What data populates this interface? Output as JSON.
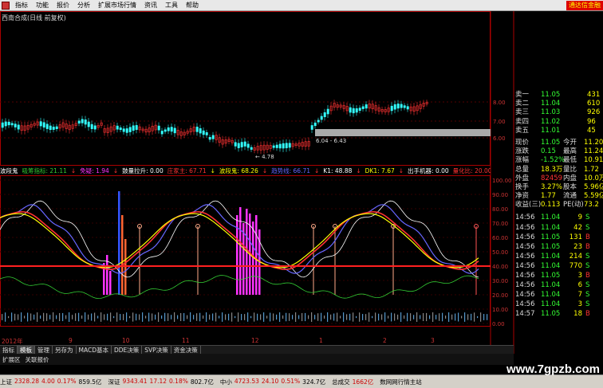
{
  "menu": {
    "items": [
      "指标",
      "功能",
      "报价",
      "分析",
      "扩展市场行情",
      "资讯",
      "工具",
      "帮助"
    ],
    "right_label": "通达信金融"
  },
  "main_title": "西南合成(日线 前复权)",
  "price_axis": [
    "8.00",
    "7.00",
    "6.00"
  ],
  "annotations": {
    "range": "6.04 - 6.43",
    "low": "4.78"
  },
  "indicator_line": [
    {
      "text": "波段鬼",
      "color": "#ffffff"
    },
    {
      "text": "吸筹指标: 21.11",
      "color": "#33cc33"
    },
    {
      "text": "↓",
      "color": "#ff3333"
    },
    {
      "text": "免疑: 1.94",
      "color": "#ff33ff"
    },
    {
      "text": "↓",
      "color": "#ff3333"
    },
    {
      "text": "鼓量拉升: 0.00",
      "color": "#ffffff"
    },
    {
      "text": "庄家主: 67.71",
      "color": "#ff3333"
    },
    {
      "text": "↓",
      "color": "#ffff00"
    },
    {
      "text": "波段鬼: 68.26",
      "color": "#ffff00"
    },
    {
      "text": "↓",
      "color": "#ff3333"
    },
    {
      "text": "趋势线: 66.71",
      "color": "#6666ff"
    },
    {
      "text": "↓",
      "color": "#ff3333"
    },
    {
      "text": "K1: 48.88",
      "color": "#ffffff"
    },
    {
      "text": "↓",
      "color": "#ff3333"
    },
    {
      "text": "DK1: 7.67",
      "color": "#ffff00"
    },
    {
      "text": "↓",
      "color": "#ff3333"
    },
    {
      "text": "出手机器: 0.00",
      "color": "#ffffff"
    },
    {
      "text": "量化比: 20.00",
      "color": "#ff3333"
    }
  ],
  "osc_axis": [
    "100.00",
    "90.00",
    "80.00",
    "70.00",
    "60.00",
    "50.00",
    "40.00",
    "30.00",
    "20.00",
    "10.00",
    "0.00"
  ],
  "quote": {
    "asks": [
      {
        "label": "卖一",
        "price": "11.05",
        "vol": "431"
      },
      {
        "label": "卖二",
        "price": "11.04",
        "vol": "610"
      },
      {
        "label": "卖三",
        "price": "11.03",
        "vol": "926"
      },
      {
        "label": "卖四",
        "price": "11.02",
        "vol": "96"
      },
      {
        "label": "卖五",
        "price": "11.01",
        "vol": "45"
      }
    ],
    "stats": [
      [
        "现价",
        "11.05",
        "今开",
        "11.20"
      ],
      [
        "涨跌",
        "0.15",
        "最高",
        "11.24"
      ],
      [
        "涨幅",
        "-1.52%",
        "最低",
        "10.91"
      ],
      [
        "总量",
        "18.3万",
        "量比",
        "1.72"
      ],
      [
        "外盘",
        "82459",
        "内盘",
        "10.0万"
      ],
      [
        "换手",
        "3.27%",
        "股本",
        "5.96亿"
      ],
      [
        "净资",
        "1.77",
        "流通",
        "5.59亿"
      ],
      [
        "收益(三)",
        "0.113",
        "PE(动)",
        "73.2"
      ]
    ]
  },
  "ticks": [
    {
      "time": "14:56",
      "price": "11.04",
      "vol": "9",
      "side": "S"
    },
    {
      "time": "14:56",
      "price": "11.04",
      "vol": "42",
      "side": "S"
    },
    {
      "time": "14:56",
      "price": "11.05",
      "vol": "131",
      "side": "B"
    },
    {
      "time": "14:56",
      "price": "11.05",
      "vol": "23",
      "side": "B"
    },
    {
      "time": "14:56",
      "price": "11.04",
      "vol": "214",
      "side": "S"
    },
    {
      "time": "14:56",
      "price": "11.04",
      "vol": "770",
      "side": "S"
    },
    {
      "time": "14:56",
      "price": "11.05",
      "vol": "3",
      "side": "B"
    },
    {
      "time": "14:56",
      "price": "11.04",
      "vol": "6",
      "side": "S"
    },
    {
      "time": "14:56",
      "price": "11.04",
      "vol": "7",
      "side": "S"
    },
    {
      "time": "14:56",
      "price": "11.04",
      "vol": "3",
      "side": "S"
    },
    {
      "time": "14:57",
      "price": "11.05",
      "vol": "18",
      "side": "B"
    }
  ],
  "xaxis": {
    "year": "2012年",
    "labels": [
      "9",
      "10",
      "11",
      "12",
      "1",
      "2",
      "3"
    ]
  },
  "tabs": [
    "指标",
    "模板",
    "管理",
    "另存为",
    "MACD基本",
    "DDE决策",
    "SVP决策",
    "资金决策"
  ],
  "tabs_row2": [
    "扩展区",
    "关联报价"
  ],
  "status": [
    {
      "label": "上证",
      "value": "2328.28",
      "pct": "4.00",
      "pct2": "0.17%",
      "amt": "859.5亿"
    },
    {
      "label": "深证",
      "value": "9343.41",
      "pct": "17.12",
      "pct2": "0.18%",
      "amt": "802.7亿"
    },
    {
      "label": "中小",
      "value": "4723.53",
      "pct": "24.10",
      "pct2": "0.51%",
      "amt": "324.7亿"
    },
    {
      "label": "总成交",
      "value": "1662亿",
      "pct": "",
      "pct2": "",
      "amt": ""
    },
    {
      "label": "数网网行情主站",
      "value": "",
      "pct": "",
      "pct2": "",
      "amt": ""
    }
  ],
  "watermark": "www.7gpzb.com",
  "colors": {
    "up": "#ff3333",
    "down": "#33ffff",
    "yellow": "#ffff00",
    "magenta": "#ff33ff",
    "blue": "#6666ff",
    "green": "#33cc33"
  }
}
